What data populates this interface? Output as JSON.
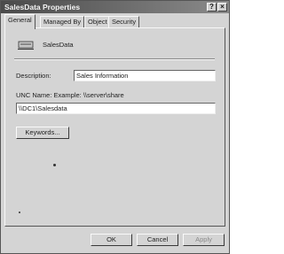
{
  "window": {
    "title": "SalesData Properties",
    "help_glyph": "?",
    "close_glyph": "×"
  },
  "tabs": [
    {
      "label": "General",
      "active": true
    },
    {
      "label": "Managed By",
      "active": false
    },
    {
      "label": "Object",
      "active": false
    },
    {
      "label": "Security",
      "active": false
    }
  ],
  "general": {
    "icon": "shared-folder-icon",
    "object_name": "SalesData",
    "description_label": "Description:",
    "description_value": "Sales Information",
    "unc_label": "UNC Name: Example: \\\\server\\share",
    "unc_value": "\\\\DC1\\Salesdata",
    "keywords_button": "Keywords..."
  },
  "footer": {
    "ok_label": "OK",
    "cancel_label": "Cancel",
    "apply_label": "Apply"
  }
}
